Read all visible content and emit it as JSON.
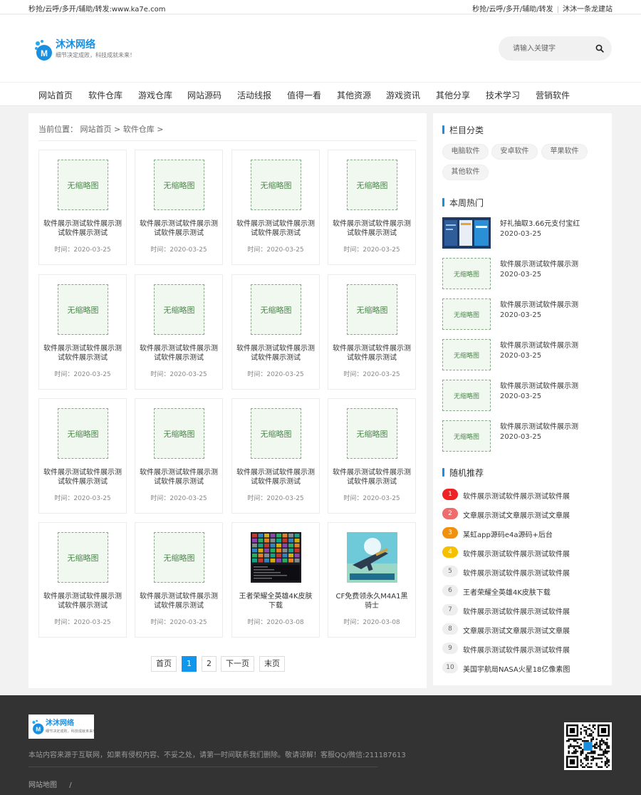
{
  "topbar": {
    "left": "秒抢/云呼/多开/辅助/转发:www.ka7e.com",
    "right1": "秒抢/云呼/多开/辅助/转发",
    "right2": "沐沐一条龙建站"
  },
  "header": {
    "logo_title": "沐沐网络",
    "logo_sub": "细节决定成败，科技成就未来！",
    "search_placeholder": "请输入关键字"
  },
  "nav": [
    "网站首页",
    "软件仓库",
    "游戏仓库",
    "网站源码",
    "活动线报",
    "值得一看",
    "其他资源",
    "游戏资讯",
    "其他分享",
    "技术学习",
    "营销软件"
  ],
  "breadcrumb": {
    "prefix": "当前位置：",
    "home": "网站首页",
    "sep": ">",
    "current": "软件仓库",
    "tail": ">"
  },
  "placeholder_label": "无缩略图",
  "cards": [
    {
      "title": "软件展示测试软件展示测试软件展示测试",
      "time": "时间：2020-03-25",
      "thumb": "none"
    },
    {
      "title": "软件展示测试软件展示测试软件展示测试",
      "time": "时间：2020-03-25",
      "thumb": "none"
    },
    {
      "title": "软件展示测试软件展示测试软件展示测试",
      "time": "时间：2020-03-25",
      "thumb": "none"
    },
    {
      "title": "软件展示测试软件展示测试软件展示测试",
      "time": "时间：2020-03-25",
      "thumb": "none"
    },
    {
      "title": "软件展示测试软件展示测试软件展示测试",
      "time": "时间：2020-03-25",
      "thumb": "none"
    },
    {
      "title": "软件展示测试软件展示测试软件展示测试",
      "time": "时间：2020-03-25",
      "thumb": "none"
    },
    {
      "title": "软件展示测试软件展示测试软件展示测试",
      "time": "时间：2020-03-25",
      "thumb": "none"
    },
    {
      "title": "软件展示测试软件展示测试软件展示测试",
      "time": "时间：2020-03-25",
      "thumb": "none"
    },
    {
      "title": "软件展示测试软件展示测试软件展示测试",
      "time": "时间：2020-03-25",
      "thumb": "none"
    },
    {
      "title": "软件展示测试软件展示测试软件展示测试",
      "time": "时间：2020-03-25",
      "thumb": "none"
    },
    {
      "title": "软件展示测试软件展示测试软件展示测试",
      "time": "时间：2020-03-25",
      "thumb": "none"
    },
    {
      "title": "软件展示测试软件展示测试软件展示测试",
      "time": "时间：2020-03-25",
      "thumb": "none"
    },
    {
      "title": "软件展示测试软件展示测试软件展示测试",
      "time": "时间：2020-03-25",
      "thumb": "none"
    },
    {
      "title": "软件展示测试软件展示测试软件展示测试",
      "time": "时间：2020-03-25",
      "thumb": "none"
    },
    {
      "title": "王者荣耀全英雄4K皮肤下载",
      "time": "时间：2020-03-08",
      "thumb": "skins"
    },
    {
      "title": "CF免费领永久M4A1黑骑士",
      "time": "时间：2020-03-08",
      "thumb": "gun"
    }
  ],
  "pager": [
    "首页",
    "1",
    "2",
    "下一页",
    "末页"
  ],
  "sidebar": {
    "categories_title": "栏目分类",
    "categories": [
      "电脑软件",
      "安卓软件",
      "苹果软件",
      "其他软件"
    ],
    "hot_title": "本周热门",
    "hot": [
      {
        "title": "好礼抽取3.66元支付宝红",
        "date": "2020-03-25",
        "thumb": "app"
      },
      {
        "title": "软件展示测试软件展示测",
        "date": "2020-03-25",
        "thumb": "none"
      },
      {
        "title": "软件展示测试软件展示测",
        "date": "2020-03-25",
        "thumb": "none"
      },
      {
        "title": "软件展示测试软件展示测",
        "date": "2020-03-25",
        "thumb": "none"
      },
      {
        "title": "软件展示测试软件展示测",
        "date": "2020-03-25",
        "thumb": "none"
      },
      {
        "title": "软件展示测试软件展示测",
        "date": "2020-03-25",
        "thumb": "none"
      }
    ],
    "random_title": "随机推荐",
    "random": [
      {
        "num": "1",
        "text": "软件展示测试软件展示测试软件展",
        "color": "#ee2222"
      },
      {
        "num": "2",
        "text": "文章展示测试文章展示测试文章展",
        "color": "#f06b6b"
      },
      {
        "num": "3",
        "text": "某虹app源码e4a源码+后台",
        "color": "#f0900e"
      },
      {
        "num": "4",
        "text": "软件展示测试软件展示测试软件展",
        "color": "#f5c000"
      },
      {
        "num": "5",
        "text": "软件展示测试软件展示测试软件展",
        "color": "#eeeeee"
      },
      {
        "num": "6",
        "text": "王者荣耀全英雄4K皮肤下载",
        "color": "#eeeeee"
      },
      {
        "num": "7",
        "text": "软件展示测试软件展示测试软件展",
        "color": "#eeeeee"
      },
      {
        "num": "8",
        "text": "文章展示测试文章展示测试文章展",
        "color": "#eeeeee"
      },
      {
        "num": "9",
        "text": "软件展示测试软件展示测试软件展",
        "color": "#eeeeee"
      },
      {
        "num": "10",
        "text": "美国宇航局NASA火星18亿像素图",
        "color": "#eeeeee"
      }
    ]
  },
  "footer": {
    "logo_title": "沐沐网络",
    "logo_sub": "细节决定成败，科技成就未来！",
    "copyright": "本站内容来源于互联网，如果有侵权内容、不妥之处，请第一时间联系我们删除。敬请谅解！客服QQ/微信:211187613",
    "sitemap": "网站地图",
    "sitemap_sep": "/"
  },
  "colors": {
    "brand": "#1a8fe0",
    "accent": "#1196ee",
    "footer_bg": "#333333"
  }
}
